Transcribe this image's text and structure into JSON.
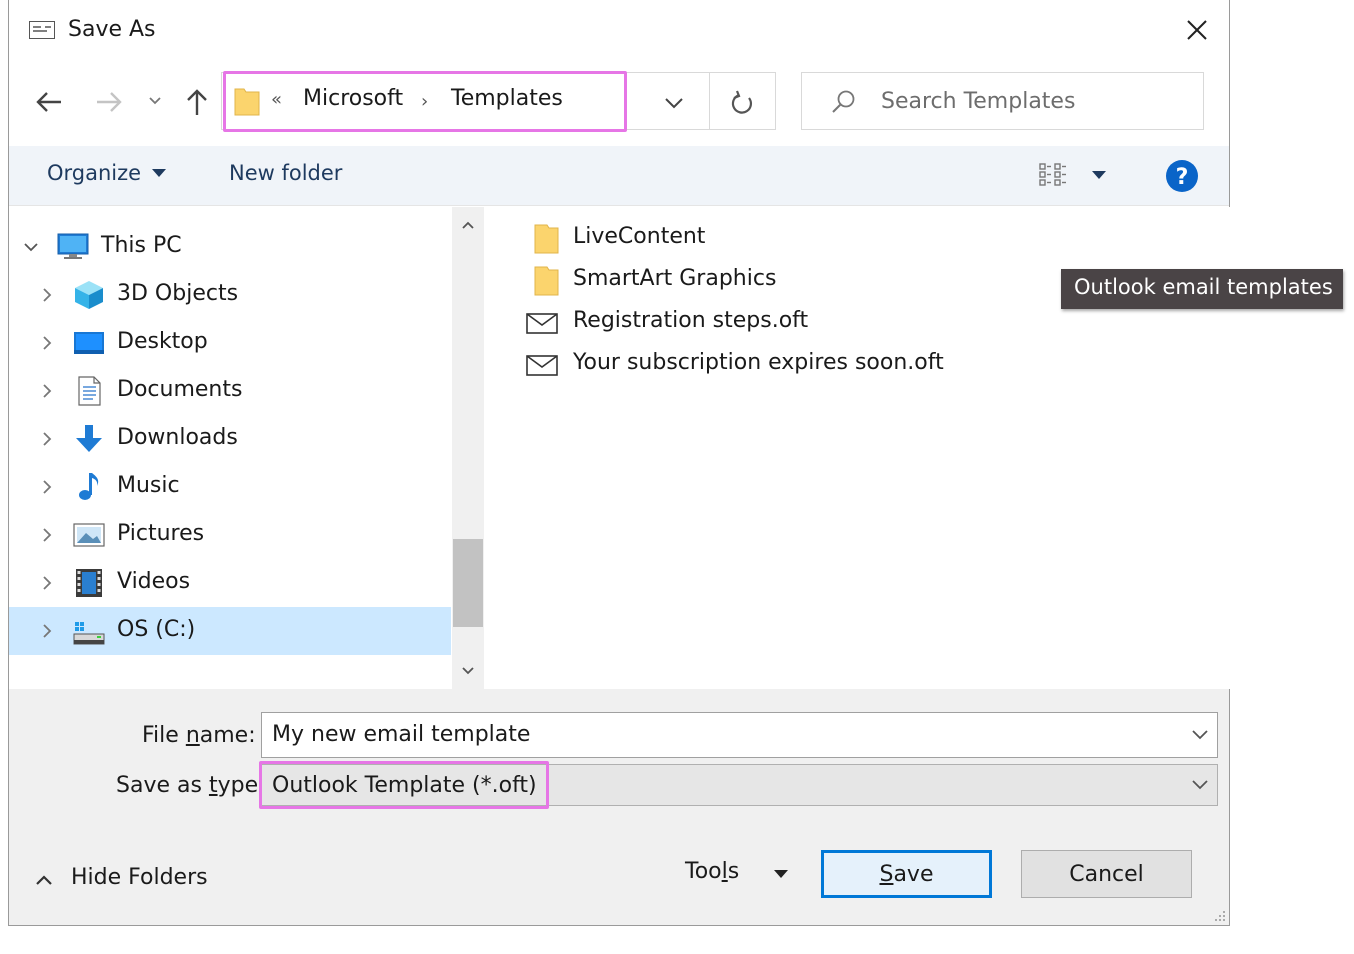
{
  "window": {
    "title": "Save As",
    "close_label": "Close"
  },
  "address": {
    "overflow_glyph": "«",
    "crumbs": [
      "Microsoft",
      "Templates"
    ],
    "crumb_separator": "›"
  },
  "search": {
    "placeholder": "Search Templates",
    "value": ""
  },
  "toolbar": {
    "organize_label": "Organize",
    "new_folder_label": "New folder",
    "help_glyph": "?"
  },
  "nav_tree": {
    "root": {
      "label": "This PC",
      "icon": "computer-icon",
      "expanded": true
    },
    "items": [
      {
        "label": "3D Objects",
        "icon": "3d-objects-icon"
      },
      {
        "label": "Desktop",
        "icon": "desktop-icon"
      },
      {
        "label": "Documents",
        "icon": "documents-icon"
      },
      {
        "label": "Downloads",
        "icon": "downloads-icon"
      },
      {
        "label": "Music",
        "icon": "music-icon"
      },
      {
        "label": "Pictures",
        "icon": "pictures-icon"
      },
      {
        "label": "Videos",
        "icon": "videos-icon"
      },
      {
        "label": "OS (C:)",
        "icon": "drive-icon",
        "selected": true
      }
    ]
  },
  "files": [
    {
      "name": "LiveContent",
      "icon": "folder-icon"
    },
    {
      "name": "SmartArt Graphics",
      "icon": "folder-icon"
    },
    {
      "name": "Registration steps.oft",
      "icon": "email-template-icon"
    },
    {
      "name": "Your subscription expires soon.oft",
      "icon": "email-template-icon"
    }
  ],
  "tooltip": {
    "text": "Outlook email templates"
  },
  "form": {
    "file_name_label_pre": "File ",
    "file_name_label_key": "n",
    "file_name_label_post": "ame:",
    "file_name_value": "My new email template",
    "save_type_label_pre": "Save as ",
    "save_type_label_key": "t",
    "save_type_label_post": "ype:",
    "save_type_value": "Outlook Template (*.oft)"
  },
  "footer": {
    "hide_folders_label": "Hide Folders",
    "tools_label_pre": "Too",
    "tools_label_key": "l",
    "tools_label_post": "s",
    "save_label_key": "S",
    "save_label_post": "ave",
    "cancel_label": "Cancel"
  },
  "colors": {
    "highlight": "#e676e6",
    "selection": "#cce8ff",
    "accent": "#0078d7",
    "folder": "#fbd46d"
  }
}
